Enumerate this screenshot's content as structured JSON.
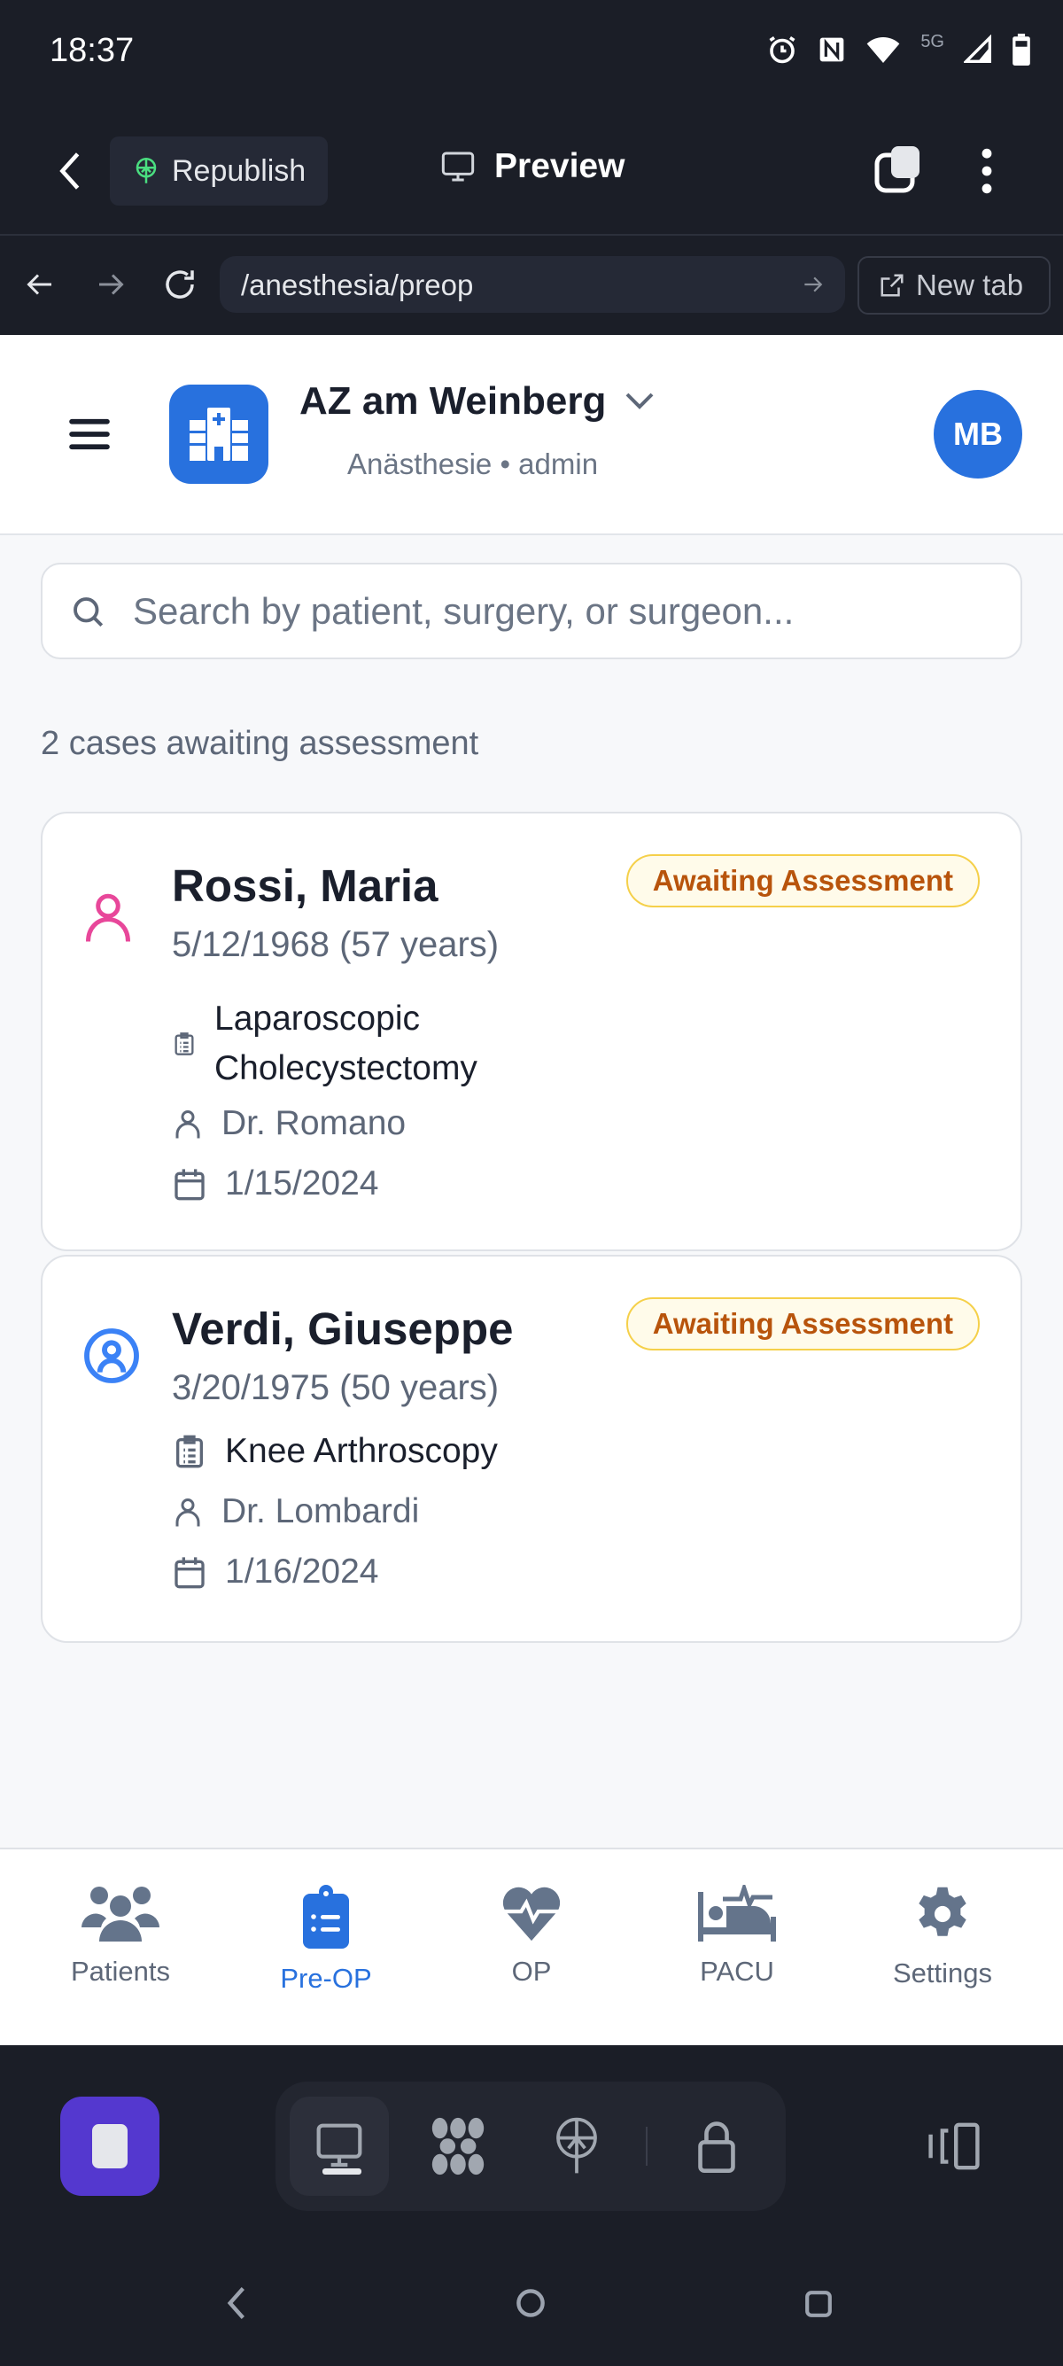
{
  "status": {
    "time": "18:37",
    "network": "5G"
  },
  "toolbar": {
    "republish": "Republish",
    "preview": "Preview"
  },
  "url": {
    "path": "/anesthesia/preop",
    "new_tab": "New tab"
  },
  "header": {
    "org": "AZ am Weinberg",
    "subtitle": "Anästhesie • admin",
    "avatar": "MB"
  },
  "search": {
    "placeholder": "Search by patient, surgery, or surgeon..."
  },
  "summary": "2 cases awaiting assessment",
  "cases": [
    {
      "name": "Rossi, Maria",
      "dob": "5/12/1968 (57 years)",
      "status": "Awaiting Assessment",
      "procedure_line1": "Laparoscopic",
      "procedure_line2": "Cholecystectomy",
      "surgeon": "Dr. Romano",
      "date": "1/15/2024",
      "gender_color": "#e8479a"
    },
    {
      "name": "Verdi, Giuseppe",
      "dob": "3/20/1975 (50 years)",
      "status": "Awaiting Assessment",
      "procedure": "Knee Arthroscopy",
      "surgeon": "Dr. Lombardi",
      "date": "1/16/2024",
      "gender_color": "#3b82f6"
    }
  ],
  "nav": [
    {
      "label": "Patients"
    },
    {
      "label": "Pre-OP",
      "active": true
    },
    {
      "label": "OP"
    },
    {
      "label": "PACU"
    },
    {
      "label": "Settings"
    }
  ],
  "colors": {
    "accent": "#2871de",
    "badge_text": "#b8540c"
  }
}
